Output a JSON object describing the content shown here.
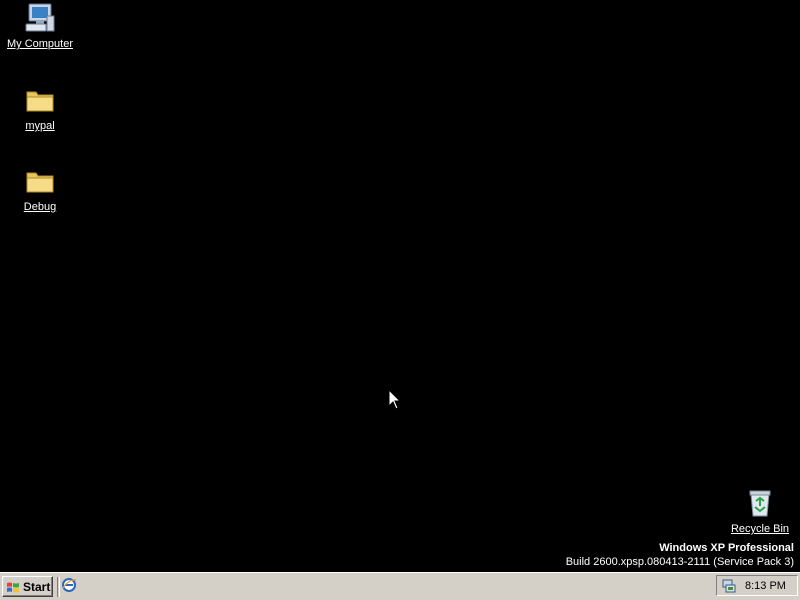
{
  "desktop": {
    "icons": [
      {
        "label": "My Computer",
        "icon": "my-computer-icon"
      },
      {
        "label": "mypal",
        "icon": "folder-icon"
      },
      {
        "label": "Debug",
        "icon": "folder-icon"
      },
      {
        "label": "Recycle Bin",
        "icon": "recycle-bin-icon"
      }
    ],
    "watermark": {
      "product": "Windows XP Professional",
      "build": "Build 2600.xpsp.080413-2111 (Service Pack 3)"
    }
  },
  "taskbar": {
    "start_label": "Start",
    "quicklaunch": [
      {
        "icon": "internet-explorer-icon"
      }
    ],
    "tray": {
      "icons": [
        {
          "icon": "network-icon"
        }
      ],
      "clock": "8:13 PM"
    },
    "colors": {
      "taskbar": "#d4d0c8",
      "desktop": "#000000"
    }
  }
}
